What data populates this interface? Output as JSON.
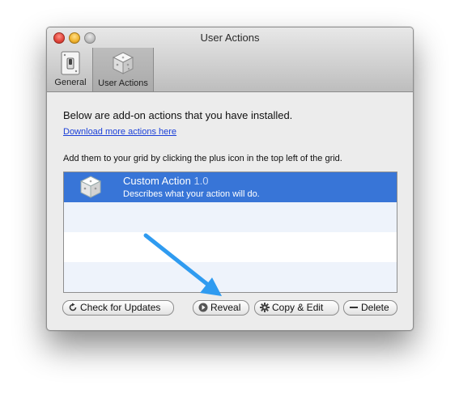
{
  "window": {
    "title": "User Actions"
  },
  "tabs": [
    {
      "label": "General",
      "icon": "switch-icon"
    },
    {
      "label": "User Actions",
      "icon": "cube-icon"
    }
  ],
  "content": {
    "intro": "Below are add-on actions that you have installed.",
    "download_link": "Download more actions here",
    "instructions": "Add them to your grid by clicking the plus icon in the top left of the grid."
  },
  "actions": [
    {
      "name": "Custom Action",
      "version": "1.0",
      "description": "Describes what your action will do.",
      "icon": "cube-icon",
      "selected": true
    }
  ],
  "buttons": {
    "check_updates": "Check for Updates",
    "reveal": "Reveal",
    "copy_edit": "Copy & Edit",
    "delete": "Delete"
  },
  "colors": {
    "selection": "#3875d7",
    "link": "#1a3fd8",
    "annotation_arrow": "#2f9bf0"
  }
}
